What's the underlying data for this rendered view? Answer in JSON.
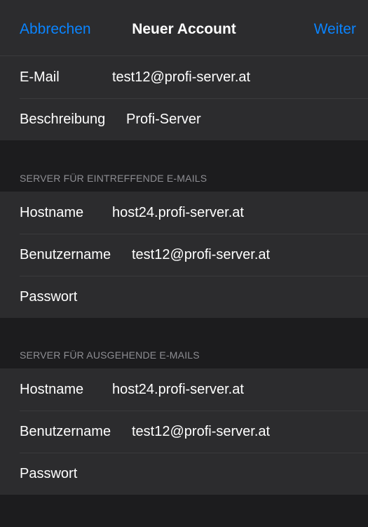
{
  "nav": {
    "cancel_label": "Abbrechen",
    "title": "Neuer Account",
    "next_label": "Weiter"
  },
  "account": {
    "email_label": "E-Mail",
    "email_value": "test12@profi-server.at",
    "description_label": "Beschreibung",
    "description_value": "Profi-Server"
  },
  "incoming": {
    "header": "SERVER FÜR EINTREFFENDE E-MAILS",
    "hostname_label": "Hostname",
    "hostname_value": "host24.profi-server.at",
    "username_label": "Benutzername",
    "username_value": "test12@profi-server.at",
    "password_label": "Passwort",
    "password_value": ""
  },
  "outgoing": {
    "header": "SERVER FÜR AUSGEHENDE E-MAILS",
    "hostname_label": "Hostname",
    "hostname_value": "host24.profi-server.at",
    "username_label": "Benutzername",
    "username_value": "test12@profi-server.at",
    "password_label": "Passwort",
    "password_value": ""
  },
  "colors": {
    "accent": "#0a84ff",
    "background": "#1c1c1e",
    "cell": "#2c2c2e",
    "separator": "#3a3a3c",
    "header_text": "#8e8e93"
  }
}
